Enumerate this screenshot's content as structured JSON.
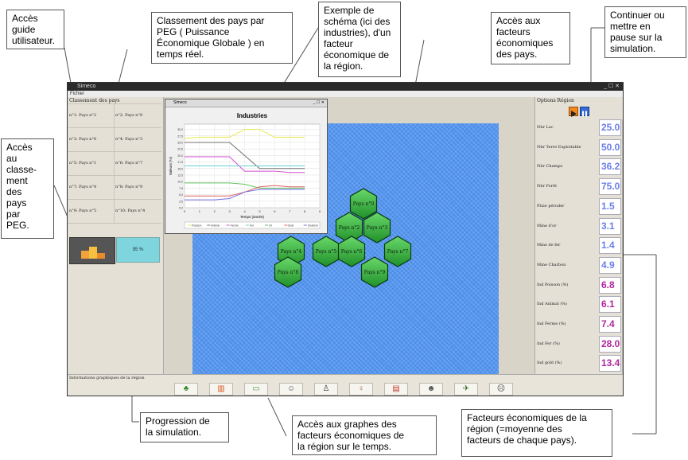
{
  "callouts": {
    "guide": "Accès\nguide\nutilisateur.",
    "classement": "Classement des pays par\nPEG ( Puissance\nÉconomique Globale ) en\ntemps réel.",
    "exemple": "Exemple de\nschéma (ici des\nindustries), d'un\nfacteur\néconomique de\nla région.",
    "acces_facteurs": "Accès aux\nfacteurs\néconomiques\ndes pays.",
    "continuer": "Continuer ou\nmettre en\npause sur la\nsimulation.",
    "acces_classement": "Accès\nau\nclasse-\nment\ndes\npays\npar\nPEG.",
    "progression": "Progression de\nla simulation.",
    "graphes": "Accès aux graphes des\nfacteurs économiques de\nla région sur le temps.",
    "facteurs_region": "Facteurs économiques de la\nrégion (=moyenne des\nfacteurs de chaque pays)."
  },
  "app": {
    "title": "Simeco",
    "menu": "Fichier",
    "left_panel_title": "Classement des pays",
    "rankings": [
      "n°1: Pays n°2",
      "n°2: Pays n°8",
      "n°3: Pays n°6",
      "n°4: Pays n°3",
      "n°5: Pays n°1",
      "n°6: Pays n°7",
      "n°7: Pays n°4",
      "n°8: Pays n°9",
      "n°9: Pays n°5",
      "n°10: Pays n°4"
    ],
    "progress": "95 %",
    "bottom_info": "Informations graphiques de la région",
    "right_panel_title": "Options Région",
    "factors": [
      {
        "label": "Nbr Lac",
        "value": "25.0",
        "color": "#6a7fe8"
      },
      {
        "label": "Nbr Terre Exploitable",
        "value": "50.0",
        "color": "#6a7fe8"
      },
      {
        "label": "Nbr Champs",
        "value": "36.2",
        "color": "#6a7fe8"
      },
      {
        "label": "Nbr Forêt",
        "value": "75.0",
        "color": "#6a7fe8"
      },
      {
        "label": "Pluie péroder",
        "value": "1.5",
        "color": "#6a7fe8"
      },
      {
        "label": "Mine d'or",
        "value": "3.1",
        "color": "#6a7fe8"
      },
      {
        "label": "Mine de fer",
        "value": "1.4",
        "color": "#6a7fe8"
      },
      {
        "label": "Mine Charbon",
        "value": "4.9",
        "color": "#6a7fe8"
      },
      {
        "label": "Ind Poisson (%)",
        "value": "6.8",
        "color": "#b0279e"
      },
      {
        "label": "Ind Animal (%)",
        "value": "6.1",
        "color": "#b0279e"
      },
      {
        "label": "Ind Ferme (%)",
        "value": "7.4",
        "color": "#b0279e"
      },
      {
        "label": "Ind Fer (%)",
        "value": "28.0",
        "color": "#b0279e"
      },
      {
        "label": "Ind gold (%)",
        "value": "13.4",
        "color": "#b0279e"
      }
    ],
    "countries": [
      "Pays n°0",
      "Pays n°2",
      "Pays n°3",
      "Pays n°4",
      "Pays n°5",
      "Pays n°6",
      "Pays n°7",
      "Pays n°8",
      "Pays n°9"
    ],
    "chart_window_title": "Simeco",
    "toolbar_icons": [
      "tree-icon",
      "factory-icon",
      "money-icon",
      "people-icon",
      "family-icon",
      "person-icon",
      "book-icon",
      "worker-icon",
      "helicopter-icon",
      "face-icon"
    ]
  },
  "chart_data": {
    "type": "line",
    "title": "Industries",
    "xlabel": "Temps (année)",
    "ylabel": "Valeurs (%)",
    "x": [
      0,
      1,
      2,
      3,
      4,
      5,
      6,
      7,
      8,
      9
    ],
    "ylim": [
      0,
      32
    ],
    "yticks": [
      "0.0",
      "2.5",
      "5.0",
      "7.5",
      "10.0",
      "12.5",
      "15.0",
      "17.5",
      "20.0",
      "22.5",
      "25.0",
      "27.5",
      "30.0"
    ],
    "series": [
      {
        "color": "#e8e84a",
        "values": [
          26.5,
          27,
          27,
          27,
          30,
          30,
          27,
          27,
          27
        ]
      },
      {
        "color": "#707070",
        "values": [
          25,
          25,
          25,
          25,
          20,
          15,
          15,
          15,
          15
        ]
      },
      {
        "color": "#d050d0",
        "values": [
          19.5,
          19.5,
          19.5,
          19.5,
          14,
          14,
          14,
          13.5,
          13.5
        ]
      },
      {
        "color": "#6ad0d0",
        "values": [
          16,
          16,
          16,
          16,
          16,
          16,
          16,
          16,
          16
        ]
      },
      {
        "color": "#60c060",
        "values": [
          9.5,
          9.5,
          9.5,
          9.5,
          9,
          7.5,
          7.5,
          7.5,
          7.5
        ]
      },
      {
        "color": "#e06060",
        "values": [
          4.5,
          4.5,
          4.5,
          4.5,
          6,
          8,
          8.5,
          8,
          8
        ]
      },
      {
        "color": "#7070e0",
        "values": [
          3,
          3,
          3,
          3.5,
          6,
          7,
          7,
          7,
          7
        ]
      }
    ],
    "legend": [
      "Poisson",
      "Animal",
      "Ferme",
      "Fer",
      "Or",
      "Bois",
      "Charbon"
    ]
  }
}
